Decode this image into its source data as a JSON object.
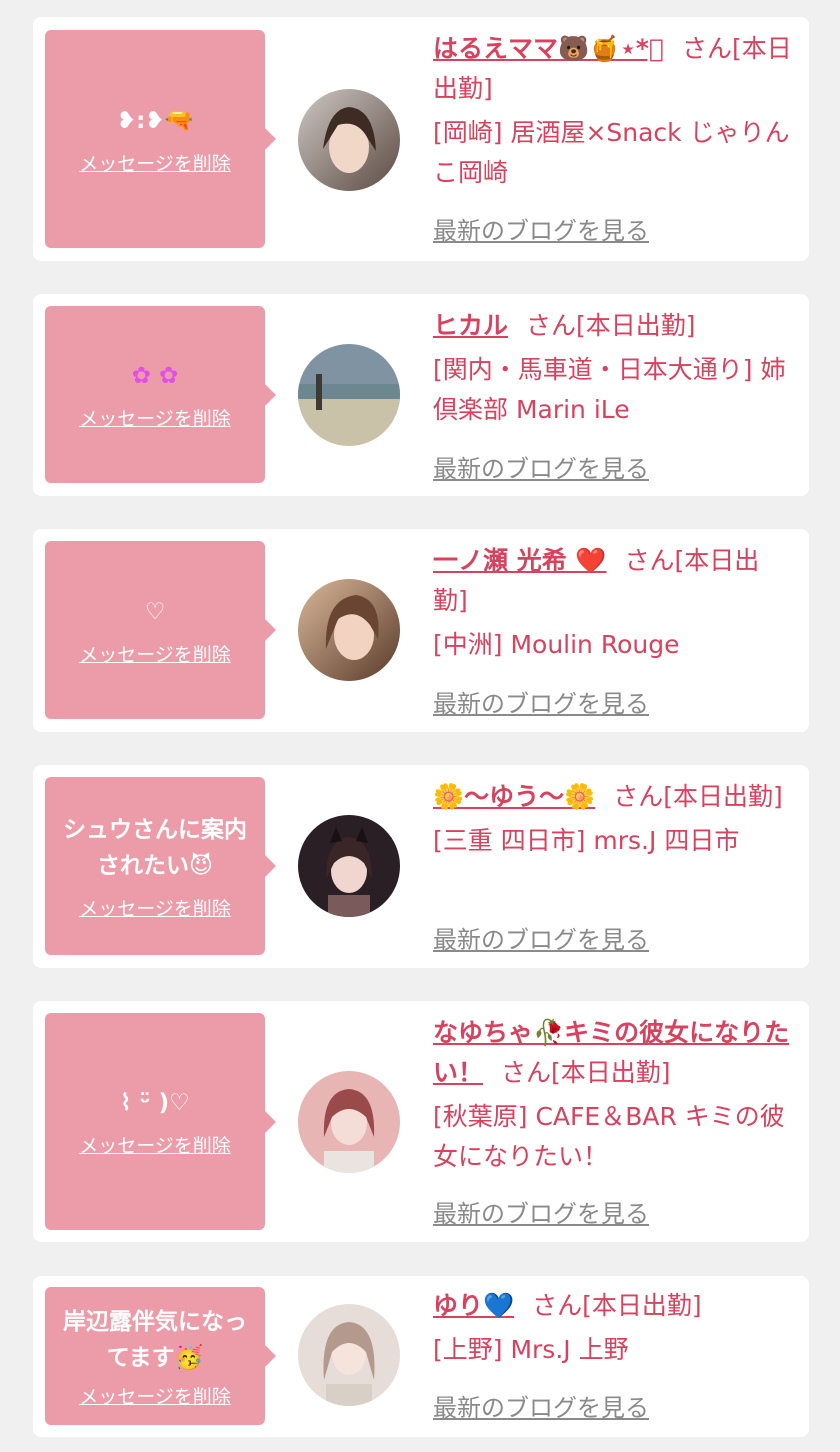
{
  "delete_label": "メッセージを削除",
  "blog_label": "最新のブログを見る",
  "cards": [
    {
      "message": "❥:❥🔫",
      "name": "はるえママ🐻🍯⋆*ﾟ",
      "suffix": "さん[本日出勤]",
      "shop": "[岡崎] 居酒屋×Snack じゃりんこ岡崎"
    },
    {
      "message": "✿ ✿",
      "name": "ヒカル",
      "suffix": "さん[本日出勤]",
      "shop": "[関内・馬車道・日本大通り] 姉倶楽部 Marin iLe"
    },
    {
      "message": "♡",
      "name": "一ノ瀬 光希 ❤️",
      "suffix": "さん[本日出勤]",
      "shop": "[中洲] Moulin Rouge"
    },
    {
      "message": "シュウさんに案内されたい😈",
      "name": "🌼〜ゆう〜🌼",
      "suffix": "さん[本日出勤]",
      "shop": "[三重 四日市] mrs.J 四日市"
    },
    {
      "message": "⌇ ᵕ̈ )♡",
      "name": "なゆちゃ🥀キミの彼女になりたい！",
      "suffix": "さん[本日出勤]",
      "shop": "[秋葉原] CAFE＆BAR キミの彼女になりたい！"
    },
    {
      "message": "岸辺露伴気になってます🥳",
      "name": "ゆり💙",
      "suffix": "さん[本日出勤]",
      "shop": "[上野] Mrs.J 上野"
    }
  ],
  "avatar_colors": [
    [
      "#cfc8c4",
      "#5b4a42"
    ],
    [
      "#7f93a3",
      "#c9c2a8"
    ],
    [
      "#d9b89a",
      "#5a3b2a"
    ],
    [
      "#2a1f24",
      "#7a5a5a"
    ],
    [
      "#e8b5b5",
      "#9a4a4a"
    ],
    [
      "#e6dcd8",
      "#b39a8c"
    ]
  ]
}
